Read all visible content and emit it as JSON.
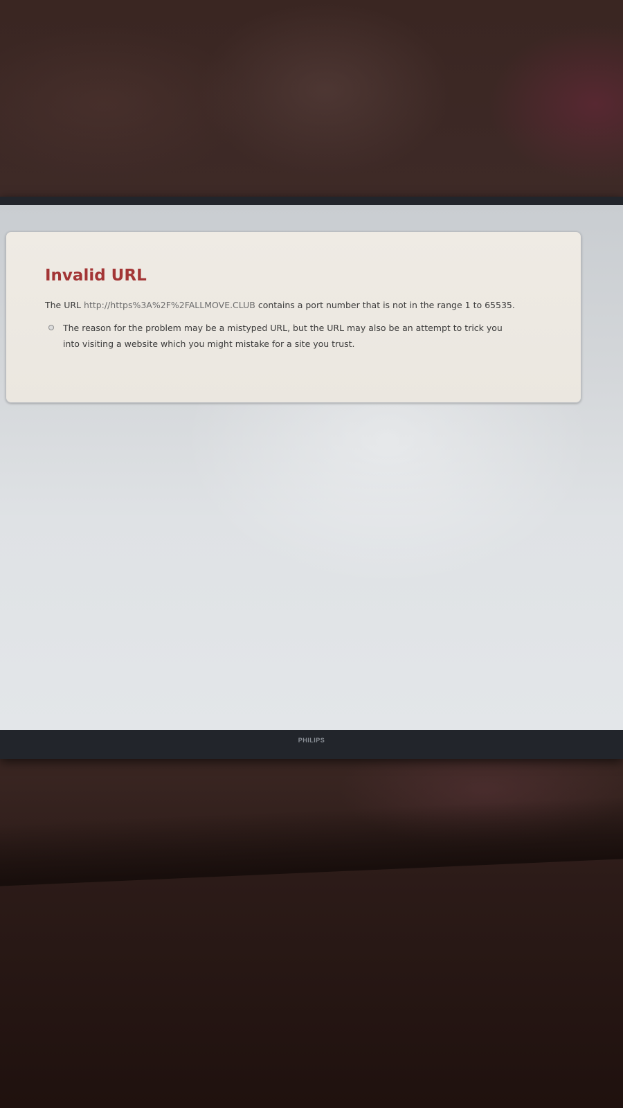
{
  "error": {
    "title": "Invalid URL",
    "desc_prefix": "The URL",
    "url": "http://https%3A%2F%2FALLMOVE.CLUB",
    "desc_suffix": "contains a port number that is not in the range 1 to 65535.",
    "reasons": [
      "The reason for the problem may be a mistyped URL, but the URL may also be an attempt to trick you into visiting a website which you might mistake for a site you trust."
    ]
  },
  "monitor": {
    "brand": "PHILIPS"
  },
  "colors": {
    "title_red": "#a33535",
    "card_background": "#efebe4",
    "screen_background": "#d3d6d9",
    "bezel": "#22252b"
  },
  "icons": {
    "reason_bullet": "circle-bullet-icon"
  }
}
